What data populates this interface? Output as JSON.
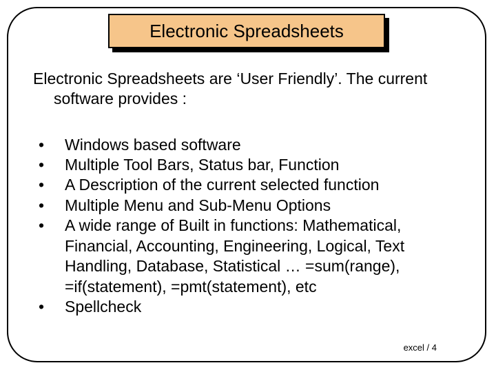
{
  "title": "Electronic Spreadsheets",
  "intro_line1": "Electronic Spreadsheets are ‘User Friendly’. The current",
  "intro_line2": "software provides :",
  "bullets": [
    "Windows based software",
    "Multiple Tool Bars, Status bar, Function",
    "A Description of the current selected function",
    "Multiple Menu and Sub-Menu Options",
    "A wide range of Built in functions: Mathematical, Financial, Accounting, Engineering, Logical, Text Handling, Database, Statistical … =sum(range), =if(statement), =pmt(statement), etc",
    "Spellcheck"
  ],
  "footer": "excel / 4"
}
